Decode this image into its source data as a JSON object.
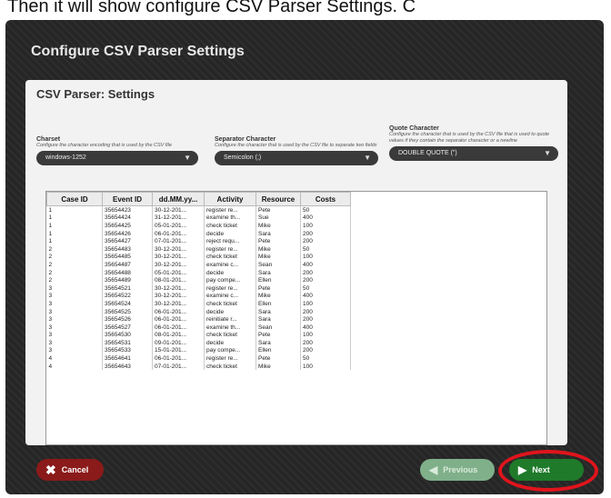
{
  "caption": "Then it will show configure CSV Parser Settings. C",
  "dialog": {
    "title": "Configure CSV Parser Settings",
    "panel_title": "CSV Parser: Settings"
  },
  "charset": {
    "label": "Charset",
    "desc": "Configure the character encoding that is used by the CSV file",
    "value": "windows-1252"
  },
  "separator": {
    "label": "Separator Character",
    "desc": "Configure the character that is used by the CSV file to separate two fields",
    "value": "Semicolon (;)"
  },
  "quote": {
    "label": "Quote Character",
    "desc": "Configure the character that is used by the CSV file that is used to quote values if they contain the separator character or a newline",
    "value": "DOUBLE QUOTE (\")"
  },
  "table": {
    "headers": [
      "Case ID",
      "Event ID",
      "dd.MM.yy...",
      "Activity",
      "Resource",
      "Costs"
    ],
    "rows": [
      [
        "1",
        "35654423",
        "30-12-201...",
        "register re...",
        "Pete",
        "50"
      ],
      [
        "1",
        "35654424",
        "31-12-201...",
        "examine th...",
        "Sue",
        "400"
      ],
      [
        "1",
        "35654425",
        "05-01-201...",
        "check ticket",
        "Mike",
        "100"
      ],
      [
        "1",
        "35654426",
        "06-01-201...",
        "decide",
        "Sara",
        "200"
      ],
      [
        "1",
        "35654427",
        "07-01-201...",
        "reject requ...",
        "Pete",
        "200"
      ],
      [
        "2",
        "35654483",
        "30-12-201...",
        "register re...",
        "Mike",
        "50"
      ],
      [
        "2",
        "35654485",
        "30-12-201...",
        "check ticket",
        "Mike",
        "100"
      ],
      [
        "2",
        "35654487",
        "30-12-201...",
        "examine c...",
        "Sean",
        "400"
      ],
      [
        "2",
        "35654488",
        "05-01-201...",
        "decide",
        "Sara",
        "200"
      ],
      [
        "2",
        "35654489",
        "08-01-201...",
        "pay compe...",
        "Ellen",
        "200"
      ],
      [
        "3",
        "35654521",
        "30-12-201...",
        "register re...",
        "Pete",
        "50"
      ],
      [
        "3",
        "35654522",
        "30-12-201...",
        "examine c...",
        "Mike",
        "400"
      ],
      [
        "3",
        "35654524",
        "30-12-201...",
        "check ticket",
        "Ellen",
        "100"
      ],
      [
        "3",
        "35654525",
        "06-01-201...",
        "decide",
        "Sara",
        "200"
      ],
      [
        "3",
        "35654526",
        "06-01-201...",
        "reinitiate r...",
        "Sara",
        "200"
      ],
      [
        "3",
        "35654527",
        "06-01-201...",
        "examine th...",
        "Sean",
        "400"
      ],
      [
        "3",
        "35654530",
        "08-01-201...",
        "check ticket",
        "Pete",
        "100"
      ],
      [
        "3",
        "35654531",
        "09-01-201...",
        "decide",
        "Sara",
        "200"
      ],
      [
        "3",
        "35654533",
        "15-01-201...",
        "pay compe...",
        "Ellen",
        "200"
      ],
      [
        "4",
        "35654641",
        "06-01-201...",
        "register re...",
        "Pete",
        "50"
      ],
      [
        "4",
        "35654643",
        "07-01-201...",
        "check ticket",
        "Mike",
        "100"
      ]
    ]
  },
  "buttons": {
    "cancel": "Cancel",
    "previous": "Previous",
    "next": "Next"
  },
  "colors": {
    "cancel": "#8b1a1a",
    "next": "#1f7a2a",
    "highlight": "#e0141c"
  }
}
